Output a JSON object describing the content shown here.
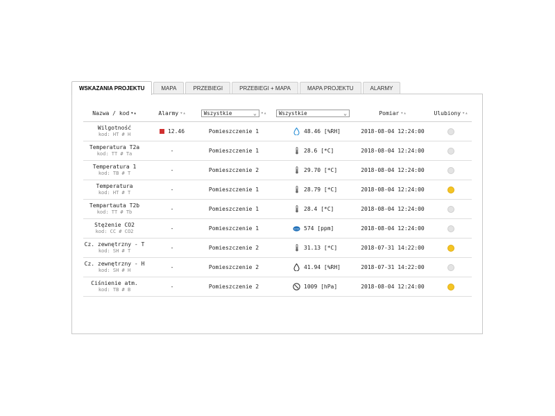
{
  "tabs": [
    {
      "label": "WSKAZANIA PROJEKTU",
      "active": true
    },
    {
      "label": "MAPA",
      "active": false
    },
    {
      "label": "PRZEBIEGI",
      "active": false
    },
    {
      "label": "PRZEBIEGI + MAPA",
      "active": false
    },
    {
      "label": "MAPA PROJEKTU",
      "active": false
    },
    {
      "label": "ALARMY",
      "active": false
    }
  ],
  "headers": {
    "name": "Nazwa / kod",
    "alarms": "Alarmy",
    "room_filter": "Wszystkie",
    "type_filter": "Wszystkie",
    "measurement": "Pomiar",
    "favorite": "Ulubiony"
  },
  "rows": [
    {
      "name": "Wilgotność",
      "code": "kod: HT # H",
      "alarm": "12.46",
      "room": "Pomieszczenie 1",
      "icon": "humidity-icon",
      "value": "48.46 [%RH]",
      "time": "2018-08-04 12:24:00",
      "fav": false
    },
    {
      "name": "Temperatura T2a",
      "code": "kod: TT # Ta",
      "alarm": "-",
      "room": "Pomieszczenie 1",
      "icon": "thermometer-icon",
      "value": "28.6 [*C]",
      "time": "2018-08-04 12:24:00",
      "fav": false
    },
    {
      "name": "Temperatura 1",
      "code": "kod: TB # T",
      "alarm": "-",
      "room": "Pomieszczenie 2",
      "icon": "thermometer-icon",
      "value": "29.70 [*C]",
      "time": "2018-08-04 12:24:00",
      "fav": false
    },
    {
      "name": "Temperatura",
      "code": "kod: HT # T",
      "alarm": "-",
      "room": "Pomieszczenie 1",
      "icon": "thermometer-icon",
      "value": "28.79 [*C]",
      "time": "2018-08-04 12:24:00",
      "fav": true
    },
    {
      "name": "Tempartauta T2b",
      "code": "kod: TT # Tb",
      "alarm": "-",
      "room": "Pomieszczenie 1",
      "icon": "thermometer-icon",
      "value": "28.4 [*C]",
      "time": "2018-08-04 12:24:00",
      "fav": false
    },
    {
      "name": "Stężenie CO2",
      "code": "kod: CC # CO2",
      "alarm": "-",
      "room": "Pomieszczenie 1",
      "icon": "co2-icon",
      "value": "574 [ppm]",
      "time": "2018-08-04 12:24:00",
      "fav": false
    },
    {
      "name": "Cz. zewnętrzny - T",
      "code": "kod: SH # T",
      "alarm": "-",
      "room": "Pomieszczenie 2",
      "icon": "thermometer-icon",
      "value": "31.13 [*C]",
      "time": "2018-07-31 14:22:00",
      "fav": true
    },
    {
      "name": "Cz. zewnętrzny - H",
      "code": "kod: SH # H",
      "alarm": "-",
      "room": "Pomieszczenie 2",
      "icon": "humidity-outline-icon",
      "value": "41.94 [%RH]",
      "time": "2018-07-31 14:22:00",
      "fav": false
    },
    {
      "name": "Ciśnienie atm.",
      "code": "kod: TB # B",
      "alarm": "-",
      "room": "Pomieszczenie 2",
      "icon": "pressure-gauge-icon",
      "value": "1009 [hPa]",
      "time": "2018-08-04 12:24:00",
      "fav": true
    }
  ],
  "icon_labels": {
    "co2": "CO2"
  },
  "colors": {
    "alarm": "#d03030",
    "favorite_on": "#f4c424",
    "favorite_off": "#e3e3e3",
    "humidity": "#2a8fd6",
    "co2": "#1f6fb8"
  }
}
